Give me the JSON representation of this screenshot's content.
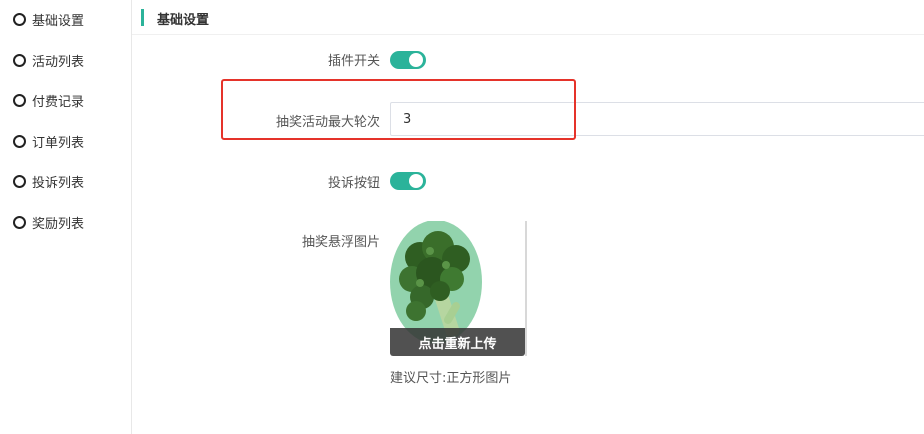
{
  "sidebar": {
    "items": [
      {
        "label": "基础设置"
      },
      {
        "label": "活动列表"
      },
      {
        "label": "付费记录"
      },
      {
        "label": "订单列表"
      },
      {
        "label": "投诉列表"
      },
      {
        "label": "奖励列表"
      }
    ]
  },
  "section": {
    "title": "基础设置"
  },
  "form": {
    "plugin_switch": {
      "label": "插件开关",
      "on": true
    },
    "max_rounds": {
      "label": "抽奖活动最大轮次",
      "value": "3"
    },
    "complaint_button": {
      "label": "投诉按钮",
      "on": true
    },
    "float_image": {
      "label": "抽奖悬浮图片",
      "reupload_label": "点击重新上传",
      "hint": "建议尺寸:正方形图片"
    }
  },
  "colors": {
    "accent": "#2bb39a",
    "highlight": "#e5332a"
  }
}
